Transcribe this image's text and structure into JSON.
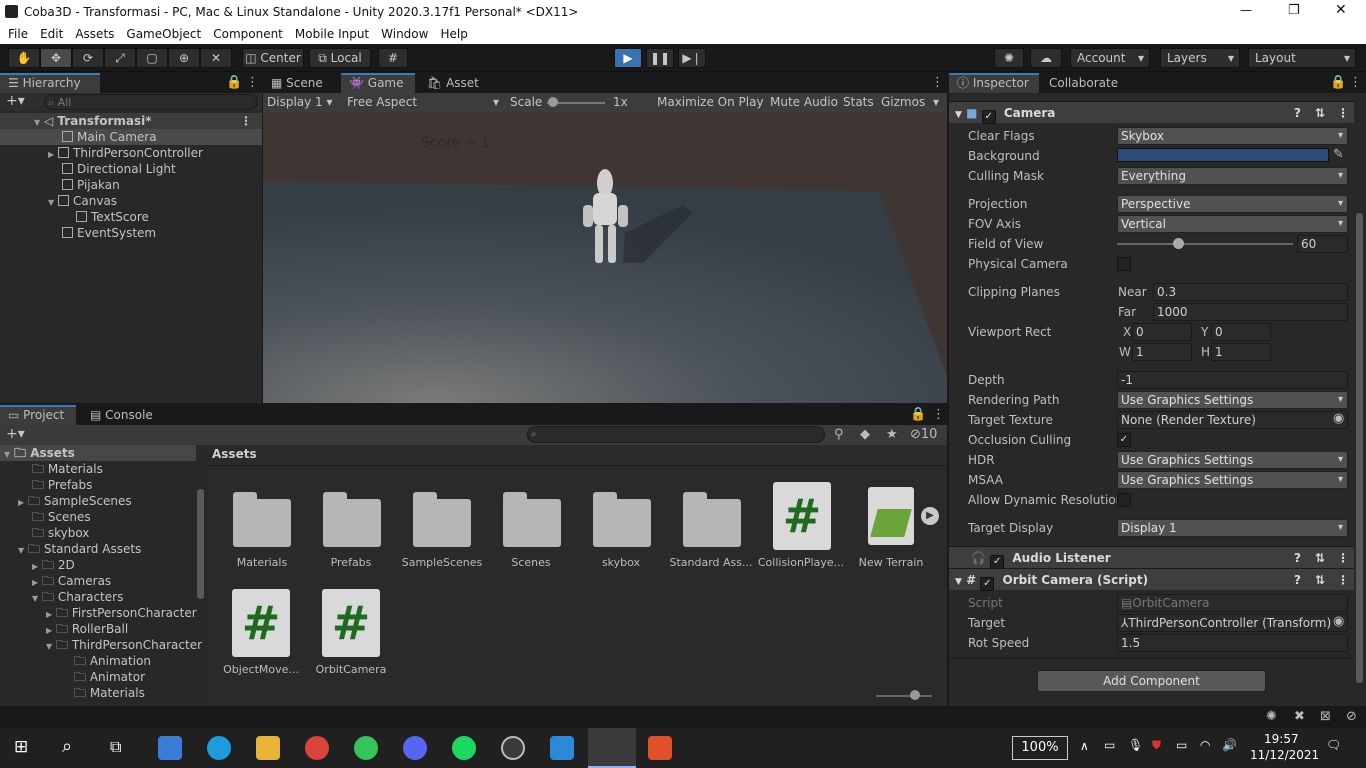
{
  "window": {
    "title": "Coba3D - Transformasi - PC, Mac & Linux Standalone - Unity 2020.3.17f1 Personal* <DX11>",
    "controls": [
      "—",
      "❐",
      "✕"
    ]
  },
  "menu": [
    "File",
    "Edit",
    "Assets",
    "GameObject",
    "Component",
    "Mobile Input",
    "Window",
    "Help"
  ],
  "toolbar": {
    "pivot": "Center",
    "space": "Local",
    "account": "Account",
    "layers": "Layers",
    "layout": "Layout"
  },
  "hierarchy": {
    "tab": "Hierarchy",
    "search_placeholder": "All",
    "scene": "Transformasi*",
    "items": [
      {
        "label": "Main Camera",
        "indent": 1
      },
      {
        "label": "ThirdPersonController",
        "indent": 1
      },
      {
        "label": "Directional Light",
        "indent": 1
      },
      {
        "label": "Pijakan",
        "indent": 1
      },
      {
        "label": "Canvas",
        "indent": 1
      },
      {
        "label": "TextScore",
        "indent": 2
      },
      {
        "label": "EventSystem",
        "indent": 1
      }
    ]
  },
  "game": {
    "tabs": [
      "Scene",
      "Game",
      "Asset Store"
    ],
    "display": "Display 1",
    "aspect": "Free Aspect",
    "scale_label": "Scale",
    "scale_value": "1x",
    "options": [
      "Maximize On Play",
      "Mute Audio",
      "Stats",
      "Gizmos"
    ],
    "score_text": "Score = 1",
    "colors": {
      "sky": "#3f3532",
      "floor": "#3b444c"
    }
  },
  "project": {
    "tabs": [
      "Project",
      "Console"
    ],
    "hidden_count": "10",
    "breadcrumb": "Assets",
    "tree": [
      {
        "label": "Assets",
        "level": 0
      },
      {
        "label": "Materials",
        "level": 1
      },
      {
        "label": "Prefabs",
        "level": 1
      },
      {
        "label": "SampleScenes",
        "level": 1
      },
      {
        "label": "Scenes",
        "level": 1
      },
      {
        "label": "skybox",
        "level": 1
      },
      {
        "label": "Standard Assets",
        "level": 1
      },
      {
        "label": "2D",
        "level": 2
      },
      {
        "label": "Cameras",
        "level": 2
      },
      {
        "label": "Characters",
        "level": 2
      },
      {
        "label": "FirstPersonCharacter",
        "level": 3
      },
      {
        "label": "RollerBall",
        "level": 3
      },
      {
        "label": "ThirdPersonCharacter",
        "level": 3
      },
      {
        "label": "Animation",
        "level": 4
      },
      {
        "label": "Animator",
        "level": 4
      },
      {
        "label": "Materials",
        "level": 4
      }
    ],
    "assets": [
      {
        "label": "Materials",
        "type": "folder"
      },
      {
        "label": "Prefabs",
        "type": "folder"
      },
      {
        "label": "SampleScenes",
        "type": "folder"
      },
      {
        "label": "Scenes",
        "type": "folder"
      },
      {
        "label": "skybox",
        "type": "folder"
      },
      {
        "label": "Standard Ass...",
        "type": "folder"
      },
      {
        "label": "CollisionPlaye...",
        "type": "script"
      },
      {
        "label": "New Terrain",
        "type": "terrain"
      },
      {
        "label": "ObjectMove...",
        "type": "script"
      },
      {
        "label": "OrbitCamera",
        "type": "script"
      }
    ]
  },
  "inspector": {
    "tabs": [
      "Inspector",
      "Collaborate"
    ],
    "camera": {
      "title": "Camera",
      "clear_flags": {
        "label": "Clear Flags",
        "value": "Skybox"
      },
      "background": {
        "label": "Background",
        "color": "#2f4a7a"
      },
      "culling_mask": {
        "label": "Culling Mask",
        "value": "Everything"
      },
      "projection": {
        "label": "Projection",
        "value": "Perspective"
      },
      "fov_axis": {
        "label": "FOV Axis",
        "value": "Vertical"
      },
      "fov": {
        "label": "Field of View",
        "value": "60"
      },
      "physical": {
        "label": "Physical Camera"
      },
      "clipping": {
        "label": "Clipping Planes",
        "near_label": "Near",
        "near": "0.3",
        "far_label": "Far",
        "far": "1000"
      },
      "viewport": {
        "label": "Viewport Rect",
        "x_label": "X",
        "x": "0",
        "y_label": "Y",
        "y": "0",
        "w_label": "W",
        "w": "1",
        "h_label": "H",
        "h": "1"
      },
      "depth": {
        "label": "Depth",
        "value": "-1"
      },
      "rendering_path": {
        "label": "Rendering Path",
        "value": "Use Graphics Settings"
      },
      "target_texture": {
        "label": "Target Texture",
        "value": "None (Render Texture)"
      },
      "occlusion": {
        "label": "Occlusion Culling"
      },
      "hdr": {
        "label": "HDR",
        "value": "Use Graphics Settings"
      },
      "msaa": {
        "label": "MSAA",
        "value": "Use Graphics Settings"
      },
      "dynamic_res": {
        "label": "Allow Dynamic Resolution"
      },
      "target_display": {
        "label": "Target Display",
        "value": "Display 1"
      }
    },
    "audio_listener": "Audio Listener",
    "orbit": {
      "title": "Orbit Camera (Script)",
      "script_label": "Script",
      "script_value": "OrbitCamera",
      "target_label": "Target",
      "target_value": "ThirdPersonController (Transform)",
      "rot_label": "Rot Speed",
      "rot_value": "1.5"
    },
    "add_component": "Add Component"
  },
  "taskbar": {
    "zoom": "100%",
    "time": "19:57",
    "date": "11/12/2021"
  }
}
